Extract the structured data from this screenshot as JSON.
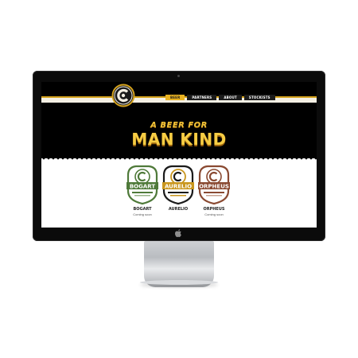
{
  "nav": {
    "items": [
      {
        "label": "BEER",
        "active": true
      },
      {
        "label": "PARTNERS",
        "active": false
      },
      {
        "label": "ABOUT",
        "active": false
      },
      {
        "label": "STOCKISTS",
        "active": false
      }
    ]
  },
  "hero": {
    "line1": "A BEER FOR",
    "line2": "MAN KIND"
  },
  "products": [
    {
      "name": "BOGART",
      "badge_text": "BOGART",
      "status": "Coming soon",
      "color": "#4f7a3a"
    },
    {
      "name": "AURELIO",
      "badge_text": "AURELIO",
      "status": "",
      "color": "#c9961e"
    },
    {
      "name": "ORPHEUS",
      "badge_text": "ORPHEUS",
      "status": "Coming soon",
      "color": "#8a4a32"
    }
  ],
  "colors": {
    "accent": "#e9b220",
    "hero_text": "#f6cd44",
    "screen_bg": "#000000"
  },
  "icons": {
    "brand": "brand-logo-icon",
    "apple": "apple-icon"
  }
}
